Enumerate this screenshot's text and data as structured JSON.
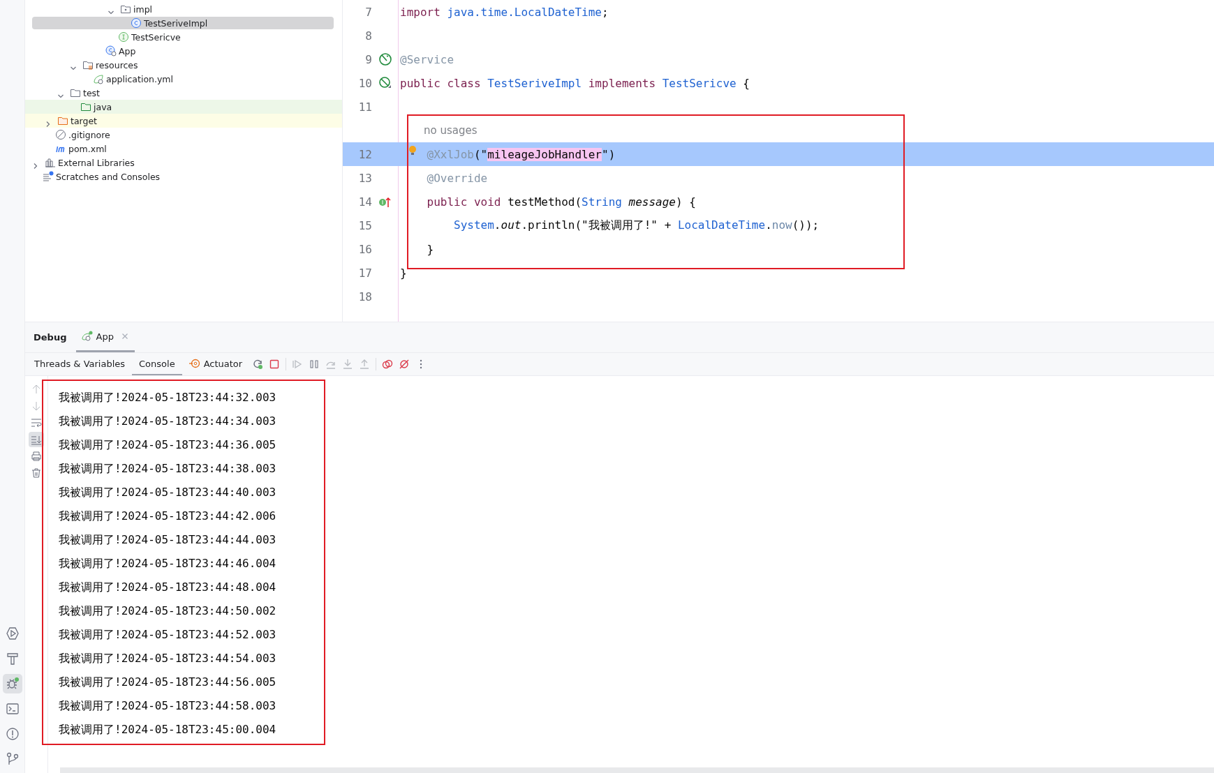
{
  "project_tree": [
    {
      "children": [
        {
          "children": [
            {
              "children": [
                {
                  "children": [
                    {
                      "children": [
                        {
                          "children": [
                            {
                              "label": "impl",
                              "kind": "package",
                              "expanded": true,
                              "selected": false,
                              "children": [
                                {
                                  "label": "TestSeriveImpl",
                                  "kind": "class",
                                  "selected": true
                                }
                              ]
                            },
                            {
                              "label": "TestSericve",
                              "kind": "interface",
                              "selected": false
                            }
                          ]
                        },
                        {
                          "label": "App",
                          "kind": "spring-class",
                          "selected": false
                        }
                      ]
                    }
                  ]
                },
                {
                  "label": "resources",
                  "kind": "resources-folder",
                  "expanded": true,
                  "selected": false,
                  "children": [
                    {
                      "label": "application.yml",
                      "kind": "spring-config",
                      "selected": false
                    }
                  ]
                }
              ]
            },
            {
              "label": "test",
              "kind": "folder",
              "expanded": true,
              "selected": false,
              "children": [
                {
                  "label": "java",
                  "kind": "test-folder",
                  "selected": false,
                  "color": "#edf7e8"
                }
              ]
            }
          ]
        },
        {
          "label": "target",
          "kind": "excluded-folder",
          "expanded": false,
          "selected": false,
          "color": "#fdfde6"
        },
        {
          "label": ".gitignore",
          "kind": "ignore",
          "selected": false
        },
        {
          "label": "pom.xml",
          "kind": "maven",
          "selected": false
        }
      ]
    },
    {
      "label": "External Libraries",
      "kind": "libraries",
      "expanded": false,
      "selected": false
    },
    {
      "label": "Scratches and Consoles",
      "kind": "scratches",
      "selected": false
    }
  ],
  "editor": {
    "lines": [
      {
        "kind": "code",
        "number": "7",
        "current": false,
        "tokens": [
          {
            "text": "import ",
            "kind": "keyword"
          },
          {
            "text": "java.time.LocalDateTime",
            "kind": "type"
          },
          {
            "text": ";",
            "kind": "plain"
          }
        ]
      },
      {
        "kind": "code",
        "number": "8",
        "current": false
      },
      {
        "kind": "code",
        "number": "9",
        "current": false,
        "marker": {
          "kind": "bean"
        },
        "tokens": [
          {
            "text": "@Service",
            "kind": "annotation"
          }
        ]
      },
      {
        "kind": "code",
        "number": "10",
        "current": false,
        "marker": {
          "kind": "bean-off"
        },
        "tokens": [
          {
            "text": "public class ",
            "kind": "keyword"
          },
          {
            "text": "TestSeriveImpl",
            "kind": "type"
          },
          {
            "text": " implements ",
            "kind": "keyword"
          },
          {
            "text": "TestSericve",
            "kind": "type"
          },
          {
            "text": " {",
            "kind": "plain"
          }
        ]
      },
      {
        "kind": "code",
        "number": "11",
        "current": false
      },
      {
        "kind": "hint",
        "text": "no usages"
      },
      {
        "kind": "code",
        "number": "12",
        "current": true,
        "bulb": true,
        "tokens": [
          {
            "text": "    @XxlJob",
            "kind": "annotation"
          },
          {
            "text": "(\"",
            "kind": "plain"
          },
          {
            "text": "mileageJobHandler",
            "kind": "match"
          },
          {
            "text": "\")",
            "kind": "plain"
          }
        ]
      },
      {
        "kind": "code",
        "number": "13",
        "current": false,
        "tokens": [
          {
            "text": "    @Override",
            "kind": "annotation"
          }
        ]
      },
      {
        "kind": "code",
        "number": "14",
        "current": false,
        "marker": {
          "kind": "implements"
        },
        "tokens": [
          {
            "text": "    public void ",
            "kind": "keyword"
          },
          {
            "text": "testMethod(",
            "kind": "plain"
          },
          {
            "text": "String",
            "kind": "type"
          },
          {
            "text": " message",
            "kind": "italic"
          },
          {
            "text": ") {",
            "kind": "plain"
          }
        ]
      },
      {
        "kind": "code",
        "number": "15",
        "current": false,
        "tokens": [
          {
            "text": "        System",
            "kind": "type"
          },
          {
            "text": ".",
            "kind": "plain"
          },
          {
            "text": "out",
            "kind": "italic"
          },
          {
            "text": ".println(\"我被调用了!\" + ",
            "kind": "plain"
          },
          {
            "text": "LocalDateTime",
            "kind": "type"
          },
          {
            "text": ".",
            "kind": "plain"
          },
          {
            "text": "now",
            "kind": "static"
          },
          {
            "text": "());",
            "kind": "plain"
          }
        ]
      },
      {
        "kind": "code",
        "number": "16",
        "current": false,
        "tokens": [
          {
            "text": "    }",
            "kind": "plain"
          }
        ]
      },
      {
        "kind": "code",
        "number": "17",
        "current": false,
        "tokens": [
          {
            "text": "}",
            "kind": "plain"
          }
        ]
      },
      {
        "kind": "code",
        "number": "18",
        "current": false
      }
    ]
  },
  "debug": {
    "title": "Debug",
    "tabs": [
      {
        "label": "App",
        "selected": true
      }
    ],
    "subtabs": [
      {
        "label": "Threads & Variables",
        "selected": false
      },
      {
        "label": "Console",
        "selected": true
      },
      {
        "label": "Actuator",
        "selected": false,
        "kind": "actuator"
      }
    ],
    "toolbar": [
      {
        "kind": "rerun",
        "disabled": false
      },
      {
        "kind": "stop",
        "disabled": false
      },
      {
        "kind": "resume",
        "disabled": true
      },
      {
        "kind": "pause",
        "disabled": false
      },
      {
        "kind": "step-over",
        "disabled": true
      },
      {
        "kind": "step-into",
        "disabled": true
      },
      {
        "kind": "step-out",
        "disabled": true
      },
      {
        "kind": "breakpoints",
        "disabled": false
      },
      {
        "kind": "mute",
        "disabled": false
      },
      {
        "kind": "more",
        "disabled": false
      }
    ],
    "console_tools": [
      {
        "kind": "up",
        "selected": false,
        "disabled": true
      },
      {
        "kind": "down",
        "selected": false,
        "disabled": true
      },
      {
        "kind": "wrap",
        "selected": false,
        "disabled": false
      },
      {
        "kind": "scroll-end",
        "selected": true,
        "disabled": false
      },
      {
        "kind": "print",
        "selected": false,
        "disabled": false
      },
      {
        "kind": "trash",
        "selected": false,
        "disabled": false
      }
    ],
    "console_lines": [
      "我被调用了!2024-05-18T23:44:32.003",
      "我被调用了!2024-05-18T23:44:34.003",
      "我被调用了!2024-05-18T23:44:36.005",
      "我被调用了!2024-05-18T23:44:38.003",
      "我被调用了!2024-05-18T23:44:40.003",
      "我被调用了!2024-05-18T23:44:42.006",
      "我被调用了!2024-05-18T23:44:44.003",
      "我被调用了!2024-05-18T23:44:46.004",
      "我被调用了!2024-05-18T23:44:48.004",
      "我被调用了!2024-05-18T23:44:50.002",
      "我被调用了!2024-05-18T23:44:52.003",
      "我被调用了!2024-05-18T23:44:54.003",
      "我被调用了!2024-05-18T23:44:56.005",
      "我被调用了!2024-05-18T23:44:58.003",
      "我被调用了!2024-05-18T23:45:00.004"
    ]
  },
  "tool_stripe": [
    {
      "kind": "run",
      "selected": false
    },
    {
      "kind": "build",
      "selected": false
    },
    {
      "kind": "debug",
      "selected": true
    },
    {
      "kind": "terminal",
      "selected": false
    },
    {
      "kind": "problems",
      "selected": false
    },
    {
      "kind": "git",
      "selected": false
    }
  ]
}
